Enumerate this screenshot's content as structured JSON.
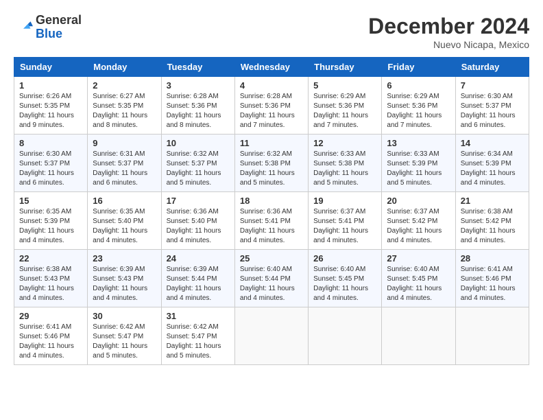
{
  "header": {
    "logo_general": "General",
    "logo_blue": "Blue",
    "month_title": "December 2024",
    "subtitle": "Nuevo Nicapa, Mexico"
  },
  "days_of_week": [
    "Sunday",
    "Monday",
    "Tuesday",
    "Wednesday",
    "Thursday",
    "Friday",
    "Saturday"
  ],
  "weeks": [
    [
      {
        "day": "1",
        "info": "Sunrise: 6:26 AM\nSunset: 5:35 PM\nDaylight: 11 hours\nand 9 minutes."
      },
      {
        "day": "2",
        "info": "Sunrise: 6:27 AM\nSunset: 5:35 PM\nDaylight: 11 hours\nand 8 minutes."
      },
      {
        "day": "3",
        "info": "Sunrise: 6:28 AM\nSunset: 5:36 PM\nDaylight: 11 hours\nand 8 minutes."
      },
      {
        "day": "4",
        "info": "Sunrise: 6:28 AM\nSunset: 5:36 PM\nDaylight: 11 hours\nand 7 minutes."
      },
      {
        "day": "5",
        "info": "Sunrise: 6:29 AM\nSunset: 5:36 PM\nDaylight: 11 hours\nand 7 minutes."
      },
      {
        "day": "6",
        "info": "Sunrise: 6:29 AM\nSunset: 5:36 PM\nDaylight: 11 hours\nand 7 minutes."
      },
      {
        "day": "7",
        "info": "Sunrise: 6:30 AM\nSunset: 5:37 PM\nDaylight: 11 hours\nand 6 minutes."
      }
    ],
    [
      {
        "day": "8",
        "info": "Sunrise: 6:30 AM\nSunset: 5:37 PM\nDaylight: 11 hours\nand 6 minutes."
      },
      {
        "day": "9",
        "info": "Sunrise: 6:31 AM\nSunset: 5:37 PM\nDaylight: 11 hours\nand 6 minutes."
      },
      {
        "day": "10",
        "info": "Sunrise: 6:32 AM\nSunset: 5:37 PM\nDaylight: 11 hours\nand 5 minutes."
      },
      {
        "day": "11",
        "info": "Sunrise: 6:32 AM\nSunset: 5:38 PM\nDaylight: 11 hours\nand 5 minutes."
      },
      {
        "day": "12",
        "info": "Sunrise: 6:33 AM\nSunset: 5:38 PM\nDaylight: 11 hours\nand 5 minutes."
      },
      {
        "day": "13",
        "info": "Sunrise: 6:33 AM\nSunset: 5:39 PM\nDaylight: 11 hours\nand 5 minutes."
      },
      {
        "day": "14",
        "info": "Sunrise: 6:34 AM\nSunset: 5:39 PM\nDaylight: 11 hours\nand 4 minutes."
      }
    ],
    [
      {
        "day": "15",
        "info": "Sunrise: 6:35 AM\nSunset: 5:39 PM\nDaylight: 11 hours\nand 4 minutes."
      },
      {
        "day": "16",
        "info": "Sunrise: 6:35 AM\nSunset: 5:40 PM\nDaylight: 11 hours\nand 4 minutes."
      },
      {
        "day": "17",
        "info": "Sunrise: 6:36 AM\nSunset: 5:40 PM\nDaylight: 11 hours\nand 4 minutes."
      },
      {
        "day": "18",
        "info": "Sunrise: 6:36 AM\nSunset: 5:41 PM\nDaylight: 11 hours\nand 4 minutes."
      },
      {
        "day": "19",
        "info": "Sunrise: 6:37 AM\nSunset: 5:41 PM\nDaylight: 11 hours\nand 4 minutes."
      },
      {
        "day": "20",
        "info": "Sunrise: 6:37 AM\nSunset: 5:42 PM\nDaylight: 11 hours\nand 4 minutes."
      },
      {
        "day": "21",
        "info": "Sunrise: 6:38 AM\nSunset: 5:42 PM\nDaylight: 11 hours\nand 4 minutes."
      }
    ],
    [
      {
        "day": "22",
        "info": "Sunrise: 6:38 AM\nSunset: 5:43 PM\nDaylight: 11 hours\nand 4 minutes."
      },
      {
        "day": "23",
        "info": "Sunrise: 6:39 AM\nSunset: 5:43 PM\nDaylight: 11 hours\nand 4 minutes."
      },
      {
        "day": "24",
        "info": "Sunrise: 6:39 AM\nSunset: 5:44 PM\nDaylight: 11 hours\nand 4 minutes."
      },
      {
        "day": "25",
        "info": "Sunrise: 6:40 AM\nSunset: 5:44 PM\nDaylight: 11 hours\nand 4 minutes."
      },
      {
        "day": "26",
        "info": "Sunrise: 6:40 AM\nSunset: 5:45 PM\nDaylight: 11 hours\nand 4 minutes."
      },
      {
        "day": "27",
        "info": "Sunrise: 6:40 AM\nSunset: 5:45 PM\nDaylight: 11 hours\nand 4 minutes."
      },
      {
        "day": "28",
        "info": "Sunrise: 6:41 AM\nSunset: 5:46 PM\nDaylight: 11 hours\nand 4 minutes."
      }
    ],
    [
      {
        "day": "29",
        "info": "Sunrise: 6:41 AM\nSunset: 5:46 PM\nDaylight: 11 hours\nand 4 minutes."
      },
      {
        "day": "30",
        "info": "Sunrise: 6:42 AM\nSunset: 5:47 PM\nDaylight: 11 hours\nand 5 minutes."
      },
      {
        "day": "31",
        "info": "Sunrise: 6:42 AM\nSunset: 5:47 PM\nDaylight: 11 hours\nand 5 minutes."
      },
      {
        "day": "",
        "info": ""
      },
      {
        "day": "",
        "info": ""
      },
      {
        "day": "",
        "info": ""
      },
      {
        "day": "",
        "info": ""
      }
    ]
  ]
}
